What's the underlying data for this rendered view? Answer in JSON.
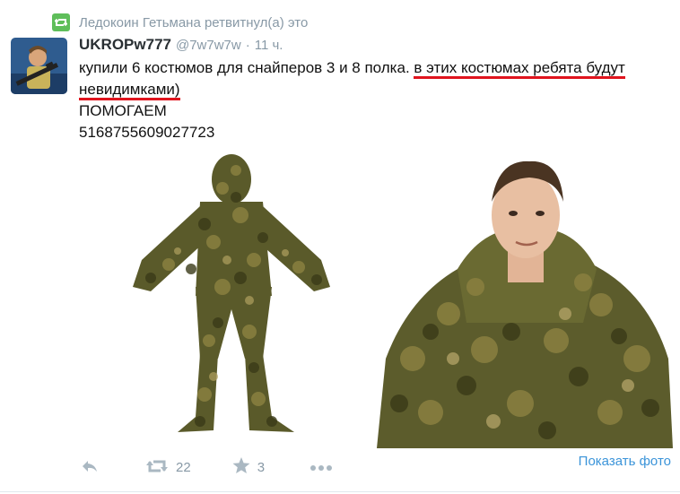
{
  "retweet": {
    "text": "Ледокоин Гетьмана ретвитнул(а) это",
    "icon": "retweet-icon",
    "badge_color": "#5fbe5a"
  },
  "tweet": {
    "display_name": "UKROPw777",
    "handle": "@7w7w7w",
    "separator": "·",
    "time": "11 ч.",
    "line1_plain": "купили 6 костюмов для снайперов 3 и 8 полка. ",
    "line1_underlined": "в этих костюмах ребята будут",
    "line2_underlined": "невидимками)",
    "line3": "ПОМОГАЕМ",
    "line4": "5168755609027723",
    "underline_color": "#e0141e"
  },
  "actions": {
    "reply_icon": "reply-icon",
    "retweet_icon": "retweet-icon",
    "retweet_count": "22",
    "favorite_icon": "star-icon",
    "favorite_count": "3",
    "more_icon": "more-icon"
  },
  "show_photo": "Показать фото",
  "colors": {
    "muted": "#8899a6",
    "link": "#3b94d9",
    "camo_dark": "#4a4a22",
    "camo_mid": "#7a7a3a",
    "camo_light": "#a89a5a"
  }
}
